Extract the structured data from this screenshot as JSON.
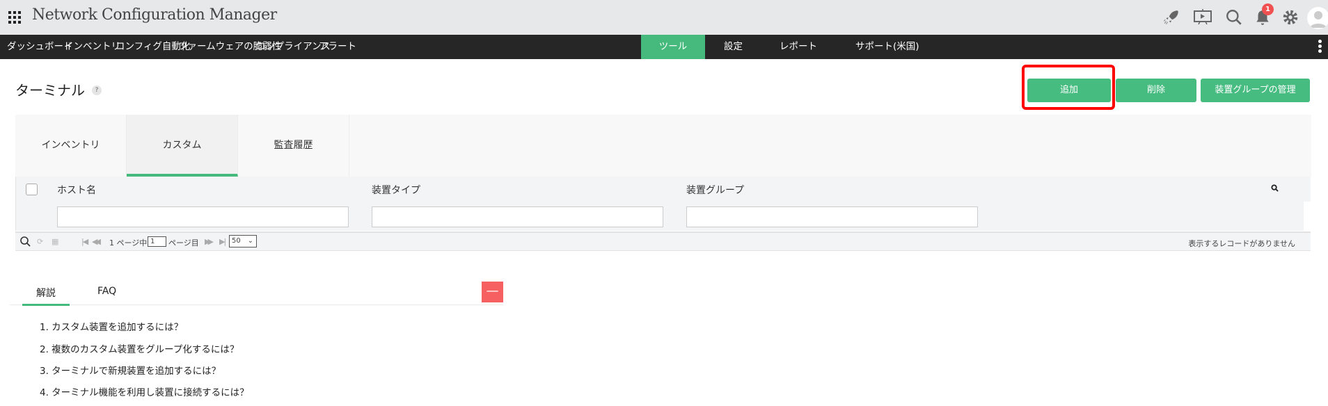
{
  "app": {
    "title": "Network Configuration Manager",
    "notification_count": "1"
  },
  "icons": [
    "apps-grid-icon",
    "rocket-icon",
    "presentation-icon",
    "search-icon",
    "bell-icon",
    "gear-icon",
    "avatar-icon",
    "kebab-menu-icon"
  ],
  "nav": {
    "items": [
      "ダッシュボード",
      "インベントリ",
      "コンフィグ自動化",
      "ファームウェアの脆弱性",
      "コンプライアンス",
      "アラート",
      "ツール",
      "設定",
      "レポート",
      "サポート(米国)"
    ],
    "active": "ツール"
  },
  "page": {
    "title": "ターミナル",
    "help": "?"
  },
  "actions": {
    "add": "追加",
    "delete": "削除",
    "manage_groups": "装置グループの管理"
  },
  "tabs": {
    "items": [
      "インベントリ",
      "カスタム",
      "監査履歴"
    ],
    "active": "カスタム"
  },
  "table": {
    "columns": [
      "ホスト名",
      "装置タイプ",
      "装置グループ"
    ],
    "filters": [
      "",
      "",
      ""
    ]
  },
  "pager": {
    "current_page": "1",
    "of_label": "1 ページ中",
    "page_label": "ページ目",
    "page_size": "50",
    "empty_message": "表示するレコードがありません"
  },
  "info": {
    "tabs": [
      "解説",
      "FAQ"
    ],
    "collapse": "—",
    "questions": [
      "1. カスタム装置を追加するには？",
      "2. 複数のカスタム装置をグループ化するには？",
      "3. ターミナルで新規装置を追加するには？",
      "4. ターミナル機能を利用し装置に接続するには？"
    ]
  },
  "colors": {
    "accent": "#46bc80",
    "nav_bg": "#262626",
    "danger": "#f66060",
    "highlight": "#ff0000"
  }
}
